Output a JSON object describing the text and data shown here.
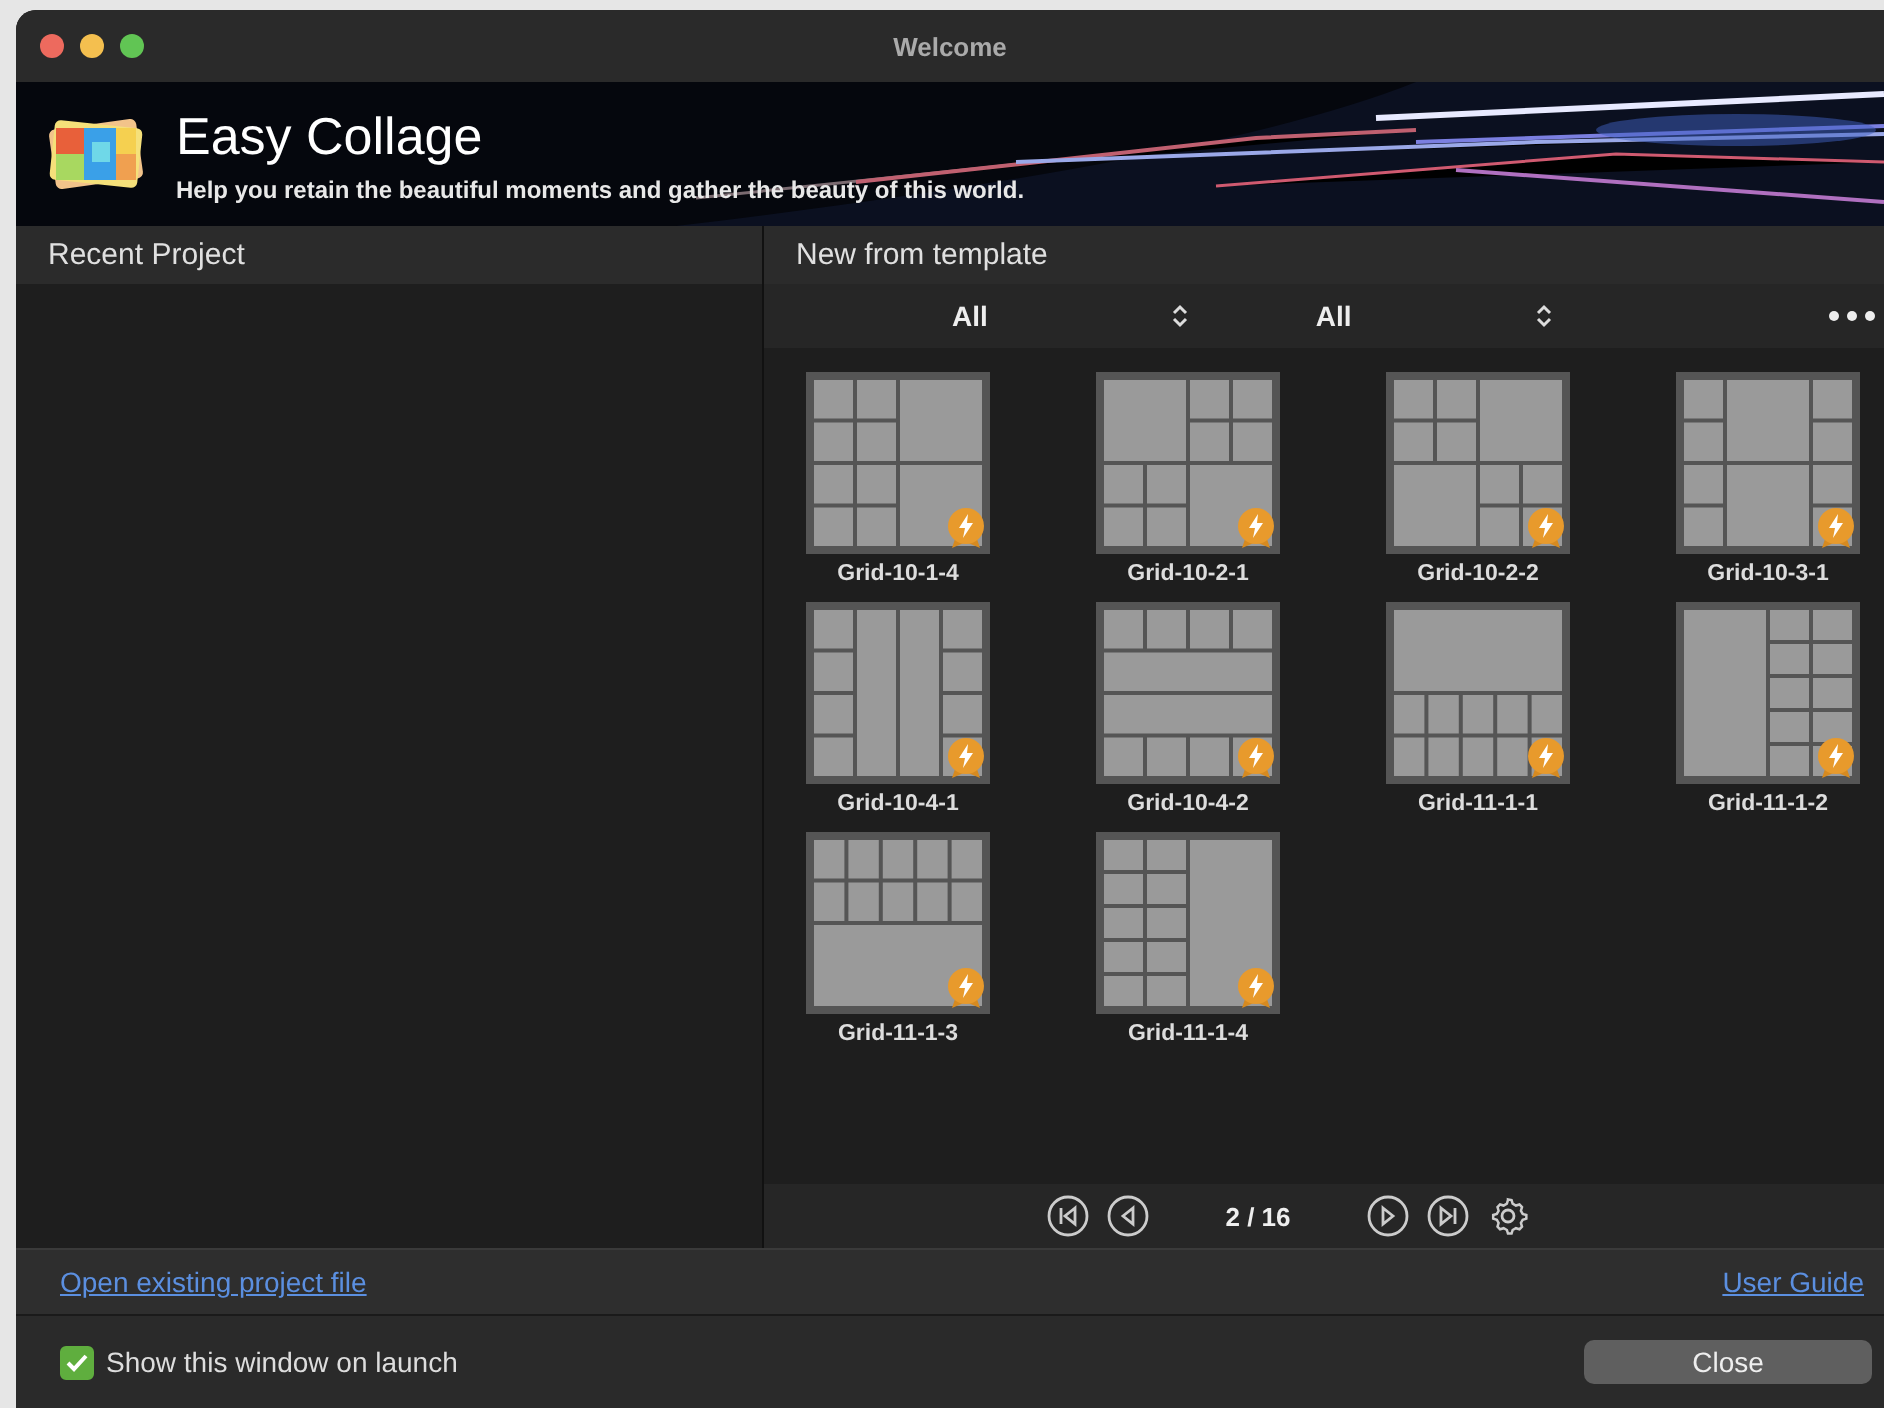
{
  "window": {
    "title": "Welcome"
  },
  "banner": {
    "app_name": "Easy Collage",
    "tagline": "Help you retain the beautiful moments and gather the beauty of this world."
  },
  "recent_project": {
    "header": "Recent Project"
  },
  "templates": {
    "header": "New from template",
    "filters": [
      {
        "value": "All"
      },
      {
        "value": "All"
      }
    ],
    "items": [
      {
        "name": "Grid-10-1-4",
        "premium": true
      },
      {
        "name": "Grid-10-2-1",
        "premium": true
      },
      {
        "name": "Grid-10-2-2",
        "premium": true
      },
      {
        "name": "Grid-10-3-1",
        "premium": true
      },
      {
        "name": "Grid-10-4-1",
        "premium": true
      },
      {
        "name": "Grid-10-4-2",
        "premium": true
      },
      {
        "name": "Grid-11-1-1",
        "premium": true
      },
      {
        "name": "Grid-11-1-2",
        "premium": true
      },
      {
        "name": "Grid-11-1-3",
        "premium": true
      },
      {
        "name": "Grid-11-1-4",
        "premium": true
      }
    ],
    "pagination": {
      "page": "2 / 16"
    }
  },
  "links": {
    "open_project": "Open existing project file",
    "user_guide": "User Guide"
  },
  "footer": {
    "show_on_launch": {
      "label": "Show this window on launch",
      "checked": true
    },
    "close_button": "Close"
  }
}
